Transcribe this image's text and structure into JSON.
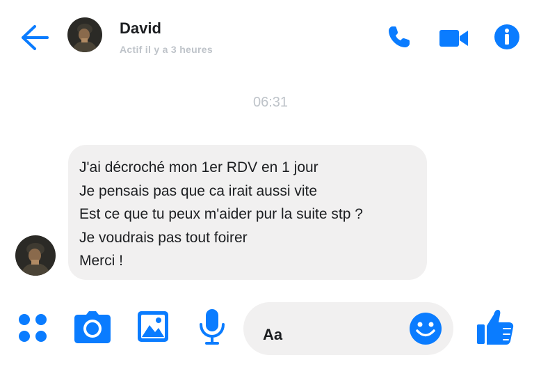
{
  "header": {
    "contact_name": "David",
    "status": "Actif il y a 3 heures"
  },
  "conversation": {
    "timestamp": "06:31",
    "messages": [
      {
        "sender": "David",
        "lines": [
          "J'ai décroché mon 1er RDV en 1 jour",
          "Je pensais pas que ca irait aussi vite",
          "Est ce que tu peux m'aider pur la suite stp ?",
          "Je voudrais pas tout foirer",
          "Merci !"
        ]
      }
    ]
  },
  "composer": {
    "placeholder": "Aa"
  },
  "icons": {
    "back": "arrow-left-icon",
    "call": "phone-icon",
    "video": "video-camera-icon",
    "info": "info-icon",
    "apps": "four-dots-icon",
    "camera": "camera-icon",
    "gallery": "image-icon",
    "mic": "microphone-icon",
    "emoji": "smiley-icon",
    "like": "thumbs-up-icon"
  },
  "colors": {
    "accent": "#0a7cff",
    "bubble": "#f1f0f0",
    "muted_text": "#bec3c9",
    "text": "#1c1e21"
  }
}
